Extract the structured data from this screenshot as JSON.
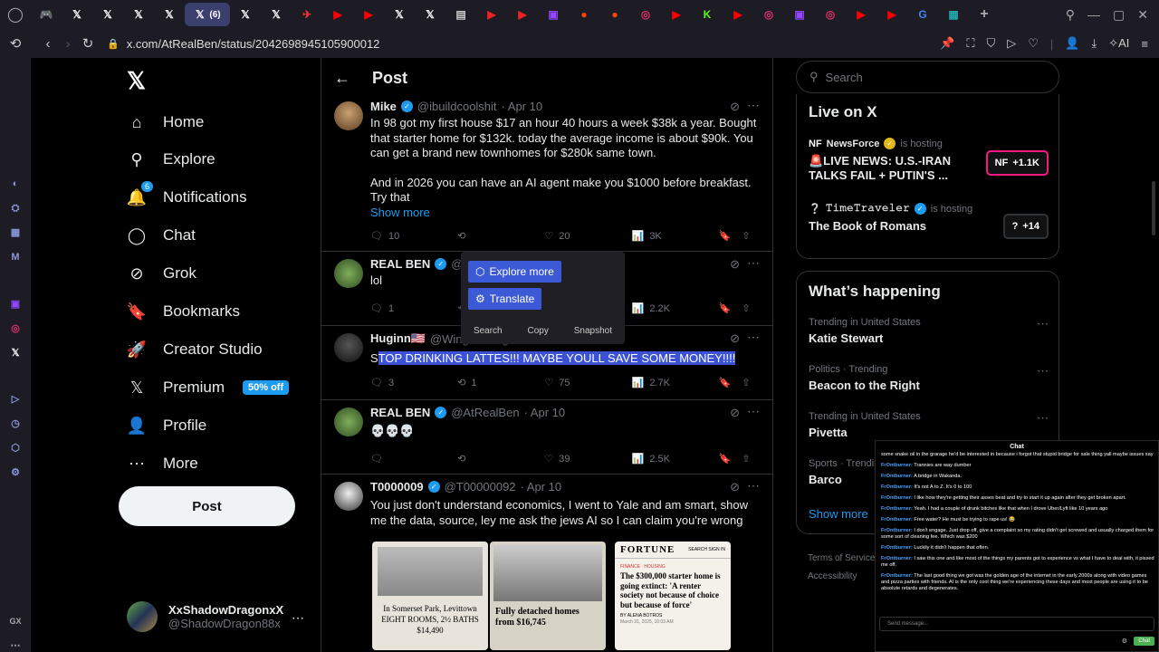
{
  "browser": {
    "tabs": [
      {
        "icon": "gamepad-icon",
        "color": "#ccc"
      },
      {
        "icon": "x-logo-icon",
        "color": "#fff"
      },
      {
        "icon": "x-logo-icon",
        "color": "#fff"
      },
      {
        "icon": "x-logo-icon",
        "color": "#fff"
      },
      {
        "icon": "x-logo-icon",
        "color": "#fff"
      },
      {
        "icon": "x-logo-icon",
        "color": "#fff",
        "active": true,
        "count": "(6)"
      },
      {
        "icon": "x-logo-icon",
        "color": "#fff"
      },
      {
        "icon": "x-logo-icon",
        "color": "#fff"
      },
      {
        "icon": "red-bird-icon",
        "color": "#e33"
      },
      {
        "icon": "youtube-icon",
        "color": "#f00"
      },
      {
        "icon": "youtube-icon",
        "color": "#f00"
      },
      {
        "icon": "x-logo-icon",
        "color": "#fff"
      },
      {
        "icon": "x-logo-icon",
        "color": "#fff"
      },
      {
        "icon": "newspaper-icon",
        "color": "#ccc"
      },
      {
        "icon": "play-tab-icon",
        "color": "#e22"
      },
      {
        "icon": "play-tab-icon",
        "color": "#e22"
      },
      {
        "icon": "twitch-icon",
        "color": "#9146ff"
      },
      {
        "icon": "reddit-icon",
        "color": "#ff4500"
      },
      {
        "icon": "reddit-icon",
        "color": "#ff4500"
      },
      {
        "icon": "instagram-icon",
        "color": "#e1306c"
      },
      {
        "icon": "youtube-icon",
        "color": "#f00"
      },
      {
        "icon": "kick-icon",
        "color": "#53fc18"
      },
      {
        "icon": "youtube-icon",
        "color": "#f00"
      },
      {
        "icon": "instagram-icon",
        "color": "#e1306c"
      },
      {
        "icon": "twitch-icon",
        "color": "#9146ff"
      },
      {
        "icon": "instagram-icon",
        "color": "#e1306c"
      },
      {
        "icon": "youtube-icon",
        "color": "#f00"
      },
      {
        "icon": "youtube-icon",
        "color": "#f00"
      },
      {
        "icon": "google-icon",
        "color": "#4285f4"
      },
      {
        "icon": "chart-tab-icon",
        "color": "#2aa"
      }
    ],
    "url": "x.com/AtRealBen/status/2042698945105900012",
    "address_right_label": "AI"
  },
  "nav": {
    "items": [
      {
        "label": "Home",
        "icon": "home-icon",
        "glyph": "⌂"
      },
      {
        "label": "Explore",
        "icon": "search-icon",
        "glyph": "⚲"
      },
      {
        "label": "Notifications",
        "icon": "bell-icon",
        "glyph": "🔔",
        "badge": "6"
      },
      {
        "label": "Chat",
        "icon": "chat-bubble-icon",
        "glyph": "◯"
      },
      {
        "label": "Grok",
        "icon": "grok-icon",
        "glyph": "⊘"
      },
      {
        "label": "Bookmarks",
        "icon": "bookmark-icon",
        "glyph": "🔖"
      },
      {
        "label": "Creator Studio",
        "icon": "rocket-icon",
        "glyph": "🚀"
      },
      {
        "label": "Premium",
        "icon": "x-logo-icon",
        "glyph": "𝕏",
        "promo": "50% off"
      },
      {
        "label": "Profile",
        "icon": "person-icon",
        "glyph": "👤"
      },
      {
        "label": "More",
        "icon": "more-circle-icon",
        "glyph": "⋯"
      }
    ],
    "post_label": "Post",
    "account": {
      "name": "XxShadowDragonxX",
      "handle": "@ShadowDragon88x"
    }
  },
  "main": {
    "title": "Post",
    "tweets": [
      {
        "name": "Mike",
        "handle": "@ibuildcoolshit",
        "date": "· Apr 10",
        "text_lines": [
          "In 98 got my first house $17 an hour 40 hours a week $38k a year. Bought that starter home for $132k. today the average income is about $90k.  You can get a brand new townhomes for $280k same town.",
          "",
          "And in 2026 you can have an AI agent make you $1000 before breakfast. Try that"
        ],
        "show_more": "Show more",
        "replies": "10",
        "reposts": "",
        "likes": "20",
        "views": "3K"
      },
      {
        "name": "REAL BEN",
        "handle": "@At",
        "date": "",
        "text": "lol",
        "replies": "1",
        "reposts": "",
        "likes": "",
        "views": "2.2K"
      },
      {
        "name": "Huginn🇺🇸",
        "handle": "@WingsOfHuginn",
        "date": "",
        "text_first": "S",
        "text_sel": "TOP DRINKING LATTES!!! MAYBE YOULL SAVE SOME MONEY!!!!",
        "replies": "3",
        "reposts": "1",
        "likes": "75",
        "views": "2.7K"
      },
      {
        "name": "REAL BEN",
        "handle": "@AtRealBen",
        "date": "· Apr 10",
        "text": "💀💀💀",
        "replies": "",
        "reposts": "",
        "likes": "39",
        "views": "2.5K"
      },
      {
        "name": "T0000009",
        "handle": "@T00000092",
        "date": "· Apr 10",
        "text": "You just don't understand economics, I went to Yale and am smart, show me the data, source, ley me ask the jews AI so I can claim you're wrong",
        "images": [
          {
            "caption": "In Somerset Park, Levittown EIGHT ROOMS, 2½ BATHS $14,490"
          },
          {
            "caption": "Fully detached homes from $16,745"
          },
          {
            "brand": "FORTUNE",
            "nav": "SEARCH   SIGN IN",
            "section": "FINANCE · HOUSING",
            "headline": "The $300,000 starter home is going extinct: 'A renter society not because of choice but because of force'",
            "byline": "BY ALENA BOTROS",
            "date": "March 31, 2025, 10:03 AM"
          }
        ]
      }
    ]
  },
  "popup": {
    "explore": "Explore more",
    "translate": "Translate",
    "links": [
      "Search",
      "Copy",
      "Snapshot"
    ]
  },
  "right": {
    "search_placeholder": "Search",
    "live_title": "Live on X",
    "live": [
      {
        "host": "NewsForce",
        "hosting": "is hosting",
        "title": "🚨LIVE NEWS: U.S.-IRAN TALKS FAIL + PUTIN'S ...",
        "count": "+1.1K",
        "border": "#f91880"
      },
      {
        "host": "𝚃𝚒𝚖𝚎𝚃𝚛𝚊𝚟𝚎𝚕𝚎𝚛",
        "hosting": "is hosting",
        "title": "The Book of Romans",
        "count": "+14",
        "border": "#2f3336"
      }
    ],
    "happening_title": "What’s happening",
    "trends": [
      {
        "cat": "Trending in United States",
        "name": "Katie Stewart"
      },
      {
        "cat": "Politics · Trending",
        "name": "Beacon to the Right"
      },
      {
        "cat": "Trending in United States",
        "name": "Pivetta"
      },
      {
        "cat": "Sports · Trending",
        "name": "Barco"
      }
    ],
    "show_more": "Show more",
    "footer": [
      "Terms of Service",
      "Accessibility"
    ]
  },
  "chat": {
    "title": "Chat",
    "messages": [
      {
        "user": "",
        "text": "some snake oil in the grarage he'd be interested in because i forgot that stupid bridge for sale thing yall maybe issues say"
      },
      {
        "user": "FrOntburner:",
        "text": "Trannies are way dumber"
      },
      {
        "user": "FrOntburner:",
        "text": "A bridge in Wakanda."
      },
      {
        "user": "FrOntburner:",
        "text": "It's not A to Z. It's 0 to 100"
      },
      {
        "user": "FrOntburner:",
        "text": "I like how they're getting their asses beat and try to start it up again after they get broken apart."
      },
      {
        "user": "FrOntburner:",
        "text": "Yeah. I had a couple of drunk bitches like that when I drove Uber/Lyft like 10 years ago"
      },
      {
        "user": "FrOntburner:",
        "text": "Free water? He must be trying to rape us! 😂"
      },
      {
        "user": "FrOntburner:",
        "text": "I don't engage. Just drop off, give a complaint so my rating didn't get screwed and usually charged them for some sort of cleaning fee. Which was $200"
      },
      {
        "user": "FrOntburner:",
        "text": "Luckily it didn't happen that often."
      },
      {
        "user": "FrOntburner:",
        "text": "I saw this one and like most of the things my parents got to experience vs what I have to deal with, it pissed me off."
      },
      {
        "user": "FrOntburner:",
        "text": "The last good thing we got was the golden age of the internet in the early 2000s along with video games and pizza parties with friends. AI is the only cool thing we're experiencing these days and most people are using it to be absolute retards and degenerates."
      }
    ],
    "input_placeholder": "Send message...",
    "send": "Chat"
  }
}
